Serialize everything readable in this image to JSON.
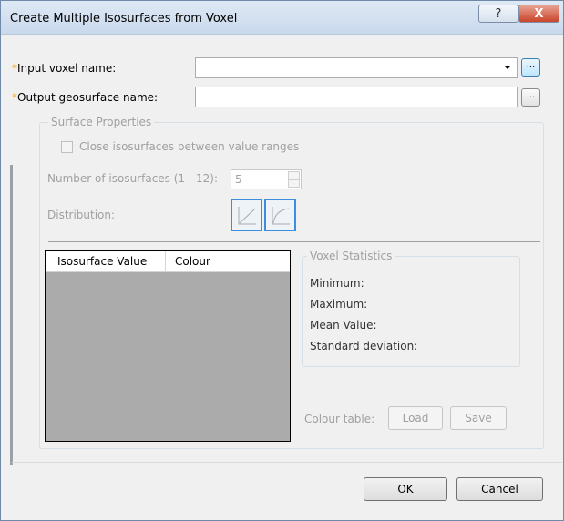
{
  "window": {
    "title": "Create Multiple Isosurfaces from Voxel",
    "help_label": "?",
    "close_label": "X"
  },
  "inputs": {
    "required_mark": "*",
    "input_voxel_label": "Input voxel name:",
    "input_voxel_value": "",
    "output_geosurface_label": "Output geosurface name:",
    "output_geosurface_value": "",
    "browse_label": "..."
  },
  "surface_properties": {
    "title": "Surface Properties",
    "close_isosurfaces_label": "Close isosurfaces between value ranges",
    "close_isosurfaces_checked": false,
    "num_isosurfaces_label": "Number of isosurfaces (1 - 12):",
    "num_isosurfaces_value": "5",
    "distribution_label": "Distribution:",
    "distribution_options": [
      "linear-distribution-icon",
      "log-distribution-icon"
    ]
  },
  "table": {
    "columns": [
      "Isosurface Value",
      "Colour"
    ],
    "rows": []
  },
  "voxel_statistics": {
    "title": "Voxel Statistics",
    "minimum_label": "Minimum:",
    "maximum_label": "Maximum:",
    "mean_label": "Mean Value:",
    "std_label": "Standard deviation:"
  },
  "colour_table": {
    "label": "Colour table:",
    "load_label": "Load",
    "save_label": "Save"
  },
  "footer": {
    "ok_label": "OK",
    "cancel_label": "Cancel"
  },
  "colors": {
    "required_star": "#f1a324",
    "disabled_text": "#a0a0a0",
    "table_background": "#ababab",
    "distribution_border": "#3b8fde"
  }
}
